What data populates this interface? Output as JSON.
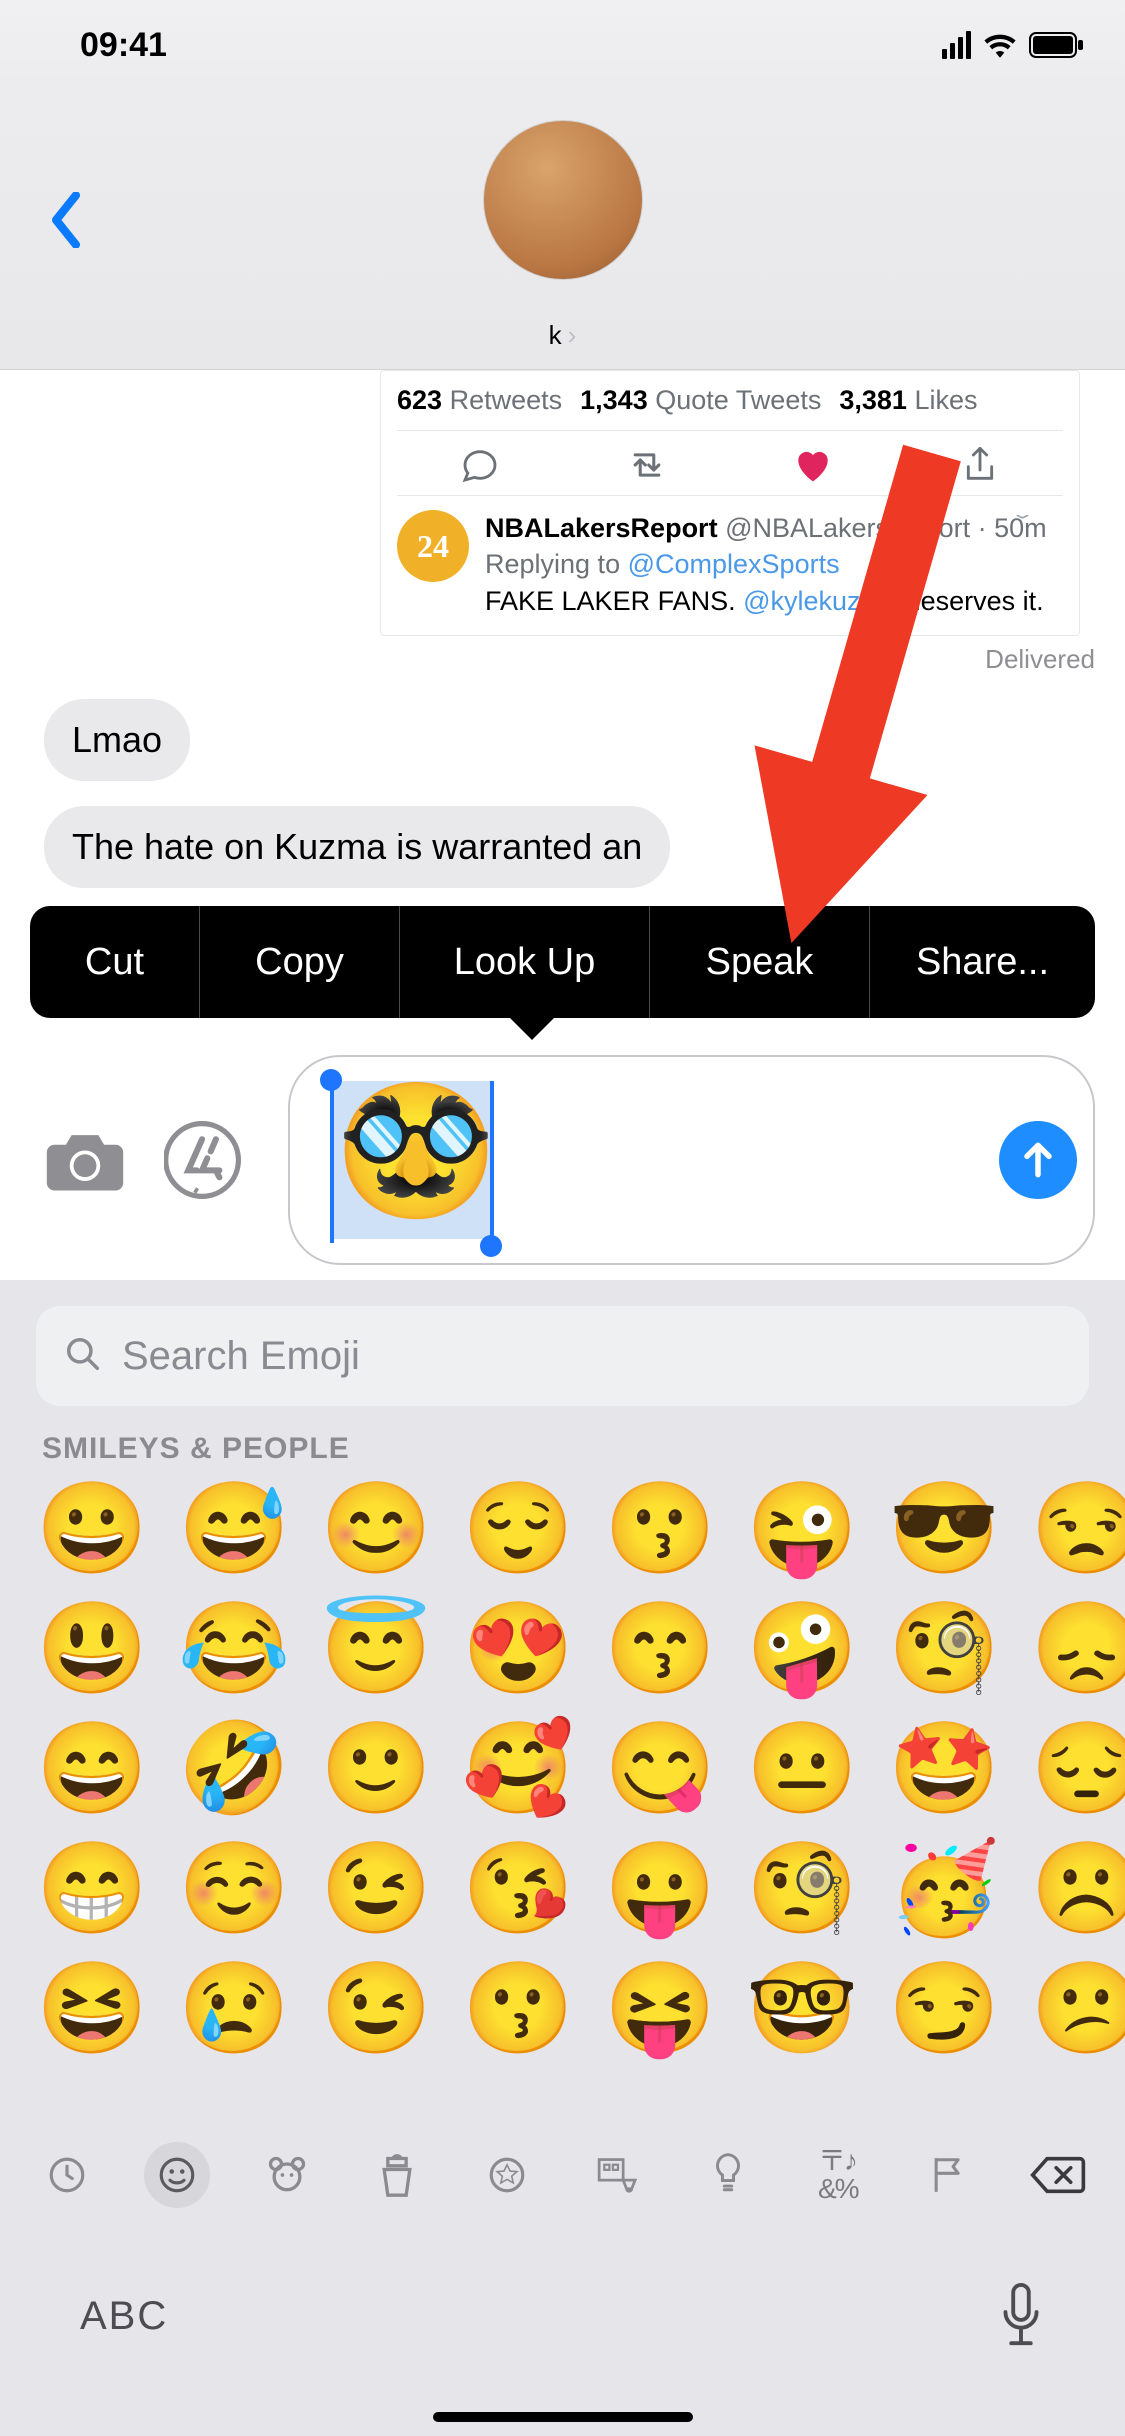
{
  "status": {
    "time": "09:41"
  },
  "header": {
    "contact_name": "k"
  },
  "tweet": {
    "retweets_n": "623",
    "retweets_l": "Retweets",
    "qt_n": "1,343",
    "qt_l": "Quote Tweets",
    "likes_n": "3,381",
    "likes_l": "Likes",
    "reply_avatar": "24",
    "reply_name": "NBALakersReport",
    "reply_handle": "@NBALakersReport",
    "reply_time": "50m",
    "reply_prefix": "Replying to ",
    "reply_to": "@ComplexSports",
    "reply_text_a": "FAKE LAKER FANS. ",
    "reply_mention": "@kylekuzma",
    "reply_text_b": " deserves it."
  },
  "delivered": "Delivered",
  "messages": {
    "in1": "Lmao",
    "in2": "The hate on Kuzma is warranted an"
  },
  "context_menu": {
    "cut": "Cut",
    "copy": "Copy",
    "lookup": "Look Up",
    "speak": "Speak",
    "share": "Share..."
  },
  "input": {
    "selected_emoji": "🥸"
  },
  "keyboard": {
    "search_placeholder": "Search Emoji",
    "section_title": "SMILEYS & PEOPLE",
    "abc": "ABC",
    "emoji": [
      "😀",
      "😅",
      "😊",
      "😌",
      "😗",
      "😜",
      "😎",
      "😒",
      "😃",
      "😂",
      "😇",
      "😍",
      "😙",
      "🤪",
      "🧐",
      "😞",
      "😄",
      "🤣",
      "🙂",
      "🥰",
      "😋",
      "😐",
      "🤩",
      "😔",
      "😁",
      "☺️",
      "😉",
      "😘",
      "😛",
      "🧐",
      "🥳",
      "☹️",
      "😆",
      "😢",
      "😉",
      "😗",
      "😝",
      "🤓",
      "😏",
      "😕"
    ],
    "categories": [
      "recent",
      "smileys",
      "animals",
      "food",
      "activity",
      "travel",
      "objects",
      "symbols",
      "flags",
      "delete"
    ]
  }
}
